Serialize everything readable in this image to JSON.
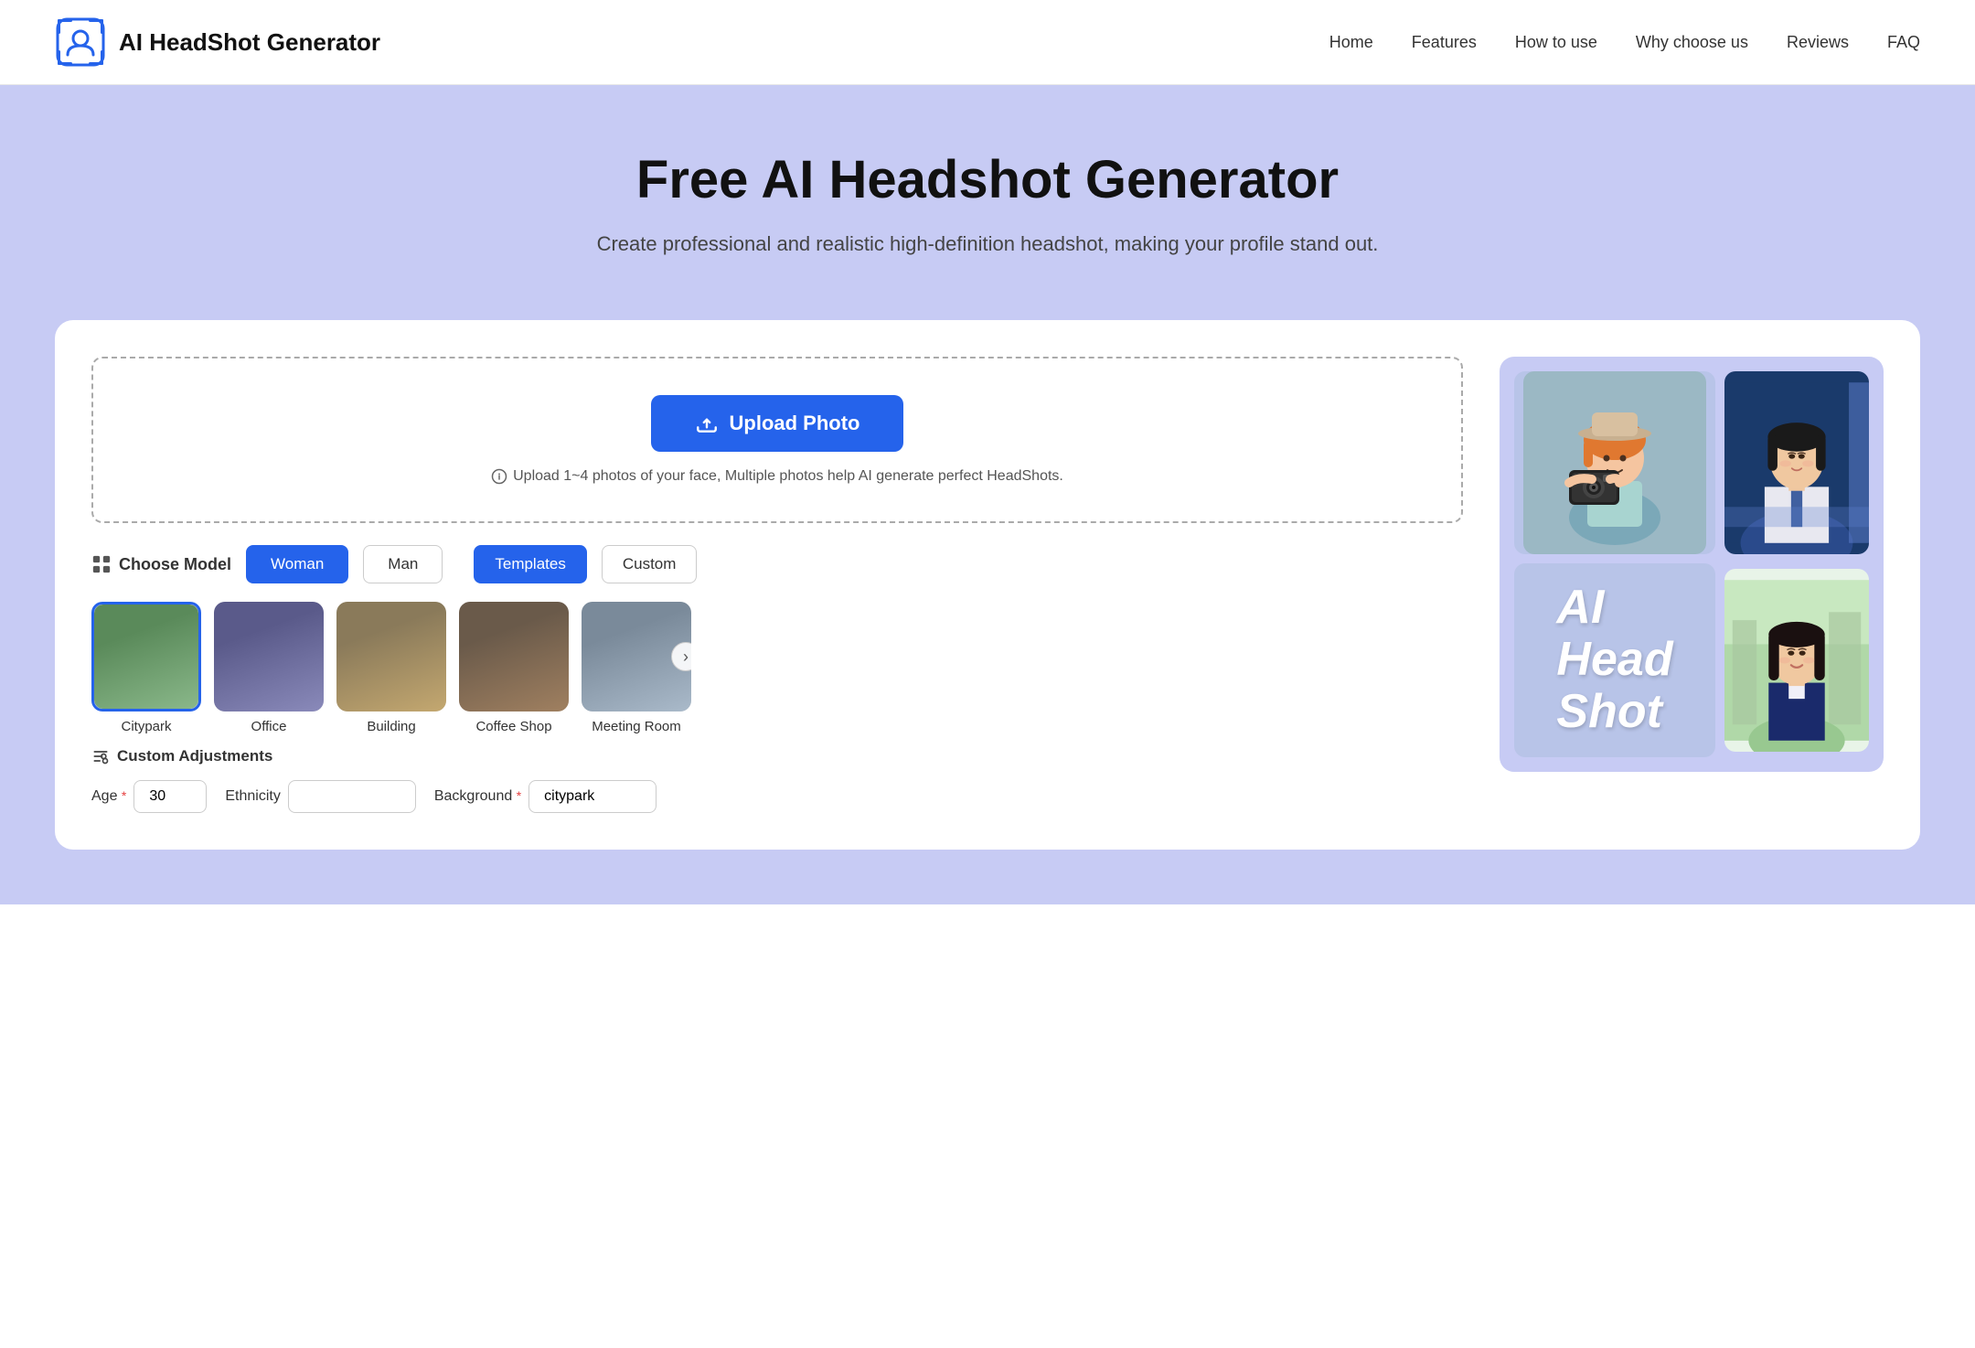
{
  "header": {
    "logo_text": "AI HeadShot Generator",
    "nav_items": [
      "Home",
      "Features",
      "How to use",
      "Why choose us",
      "Reviews",
      "FAQ"
    ]
  },
  "hero": {
    "title": "Free AI Headshot Generator",
    "subtitle": "Create professional and realistic high-definition headshot, making your profile stand out."
  },
  "upload": {
    "button_label": "Upload Photo",
    "hint": "Upload 1~4 photos of your face, Multiple photos help AI generate perfect HeadShots."
  },
  "model": {
    "section_label": "Choose Model",
    "gender_options": [
      "Woman",
      "Man"
    ],
    "mode_options": [
      "Templates",
      "Custom"
    ],
    "active_gender": "Woman",
    "active_mode": "Templates"
  },
  "templates": [
    {
      "name": "Citypark",
      "selected": true
    },
    {
      "name": "Office",
      "selected": false
    },
    {
      "name": "Building",
      "selected": false
    },
    {
      "name": "Coffee Shop",
      "selected": false
    },
    {
      "name": "Meeting Room",
      "selected": false
    }
  ],
  "custom_adjustments": {
    "label": "Custom Adjustments",
    "fields": [
      {
        "label": "Age",
        "required": true,
        "value": "30",
        "type": "text"
      },
      {
        "label": "Ethnicity",
        "required": false,
        "value": "",
        "type": "text"
      },
      {
        "label": "Background",
        "required": true,
        "value": "citypark",
        "type": "text"
      }
    ]
  },
  "collage": {
    "ai_text": "AI\nHead\nShot"
  }
}
